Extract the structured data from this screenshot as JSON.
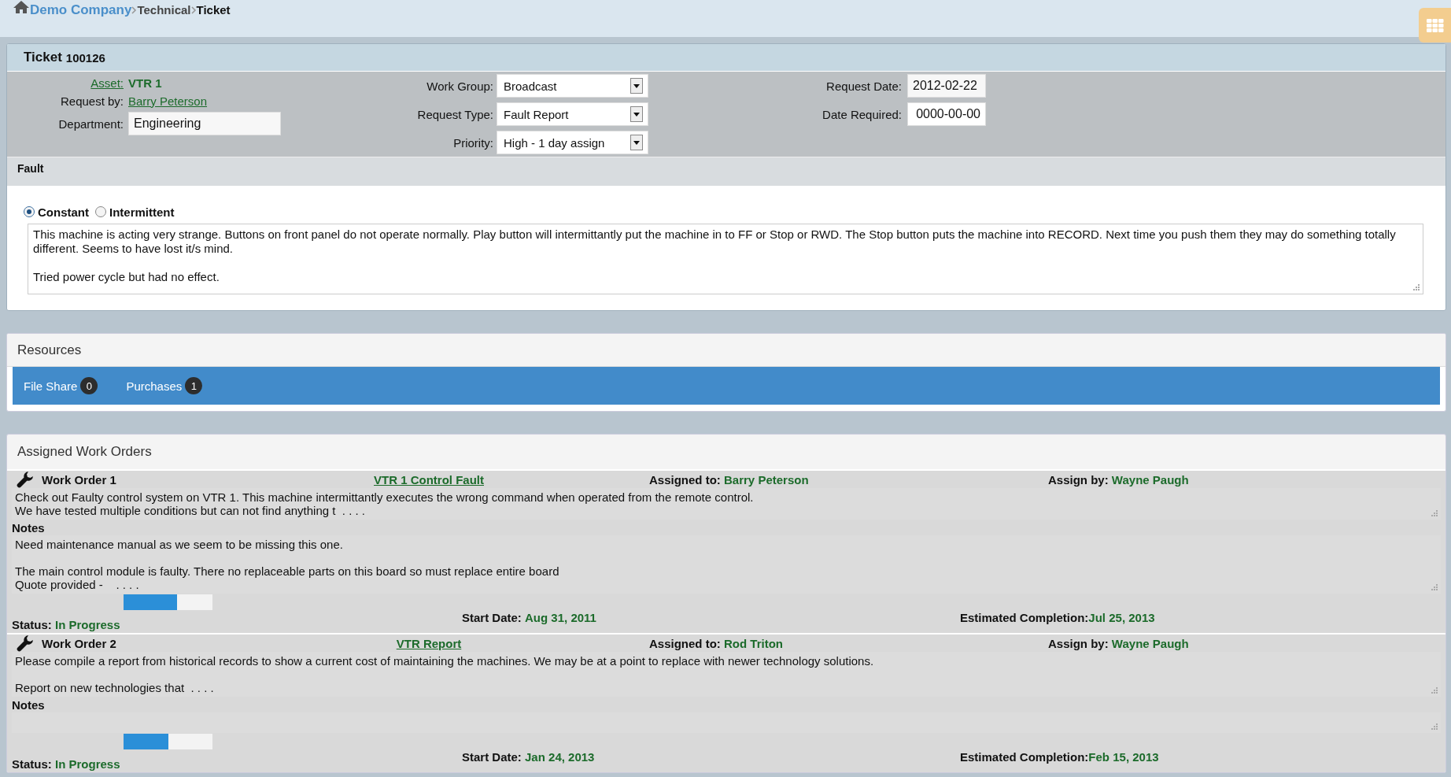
{
  "breadcrumb": [
    {
      "label": "Demo Company",
      "kind": "link"
    },
    {
      "label": "Technical",
      "kind": "section"
    },
    {
      "label": "Ticket",
      "kind": "current"
    }
  ],
  "ticket": {
    "title": "Ticket",
    "number": "100126",
    "asset": {
      "label": "Asset:",
      "value": "VTR 1"
    },
    "request_by": {
      "label": "Request by:",
      "value": "Barry Peterson"
    },
    "department": {
      "label": "Department:",
      "value": "Engineering"
    },
    "work_group": {
      "label": "Work Group:",
      "value": "Broadcast"
    },
    "request_type": {
      "label": "Request Type:",
      "value": "Fault Report"
    },
    "priority": {
      "label": "Priority:",
      "value": "High - 1 day assign"
    },
    "request_date": {
      "label": "Request Date:",
      "value": "2012-02-22"
    },
    "date_required": {
      "label": "Date Required:",
      "value": "0000-00-00"
    },
    "fault": {
      "title": "Fault",
      "options": [
        {
          "label": "Constant",
          "selected": true
        },
        {
          "label": "Intermittent",
          "selected": false
        }
      ],
      "description": "This machine is acting very strange. Buttons on front panel do not operate normally. Play button will intermittantly put the machine in to FF or Stop or RWD. The Stop button puts the machine into RECORD. Next time you push them they may do something totally different. Seems to have lost it/s mind.\n\nTried power cycle but had no effect."
    }
  },
  "resources": {
    "title": "Resources",
    "tabs": [
      {
        "label": "File Share",
        "count": "0"
      },
      {
        "label": "Purchases",
        "count": "1"
      }
    ]
  },
  "work_orders": {
    "title": "Assigned Work Orders",
    "items": [
      {
        "label": "Work Order 1",
        "title": "VTR 1 Control Fault",
        "assigned_to_label": "Assigned to:",
        "assigned_to": "Barry Peterson",
        "assign_by_label": "Assign by:",
        "assign_by": "Wayne Paugh",
        "description": "Check out Faulty control system on VTR 1. This machine intermittantly executes the wrong command when operated from the remote control.\nWe have tested multiple conditions but can not find anything t  . . . .",
        "notes_label": "Notes",
        "notes": "Need maintenance manual as we seem to be missing this one.\n\nThe main control module is faulty. There no replaceable parts on this board so must replace entire board\nQuote provided -    . . . .",
        "level": 0.6,
        "status_label": "Status:",
        "status": "In Progress",
        "start_label": "Start Date:",
        "start": "Aug 31, 2011",
        "estimate_label": "Estimated Completion:",
        "estimate": "Jul 25, 2013"
      },
      {
        "label": "Work Order 2",
        "title": "VTR Report",
        "assigned_to_label": "Assigned to:",
        "assigned_to": "Rod Triton",
        "assign_by_label": "Assign by:",
        "assign_by": "Wayne Paugh",
        "description": "Please compile a report from historical records to show a current cost of maintaining the machines. We may be at a point to replace with newer technology solutions.\n\nReport on new technologies that  . . . .",
        "notes_label": "Notes",
        "level": 0.5,
        "status_label": "Status:",
        "status": "In Progress",
        "start_label": "Start Date:",
        "start": "Jan 24, 2013",
        "estimate_label": "Estimated Completion:",
        "estimate": "Feb 15, 2013"
      }
    ]
  }
}
